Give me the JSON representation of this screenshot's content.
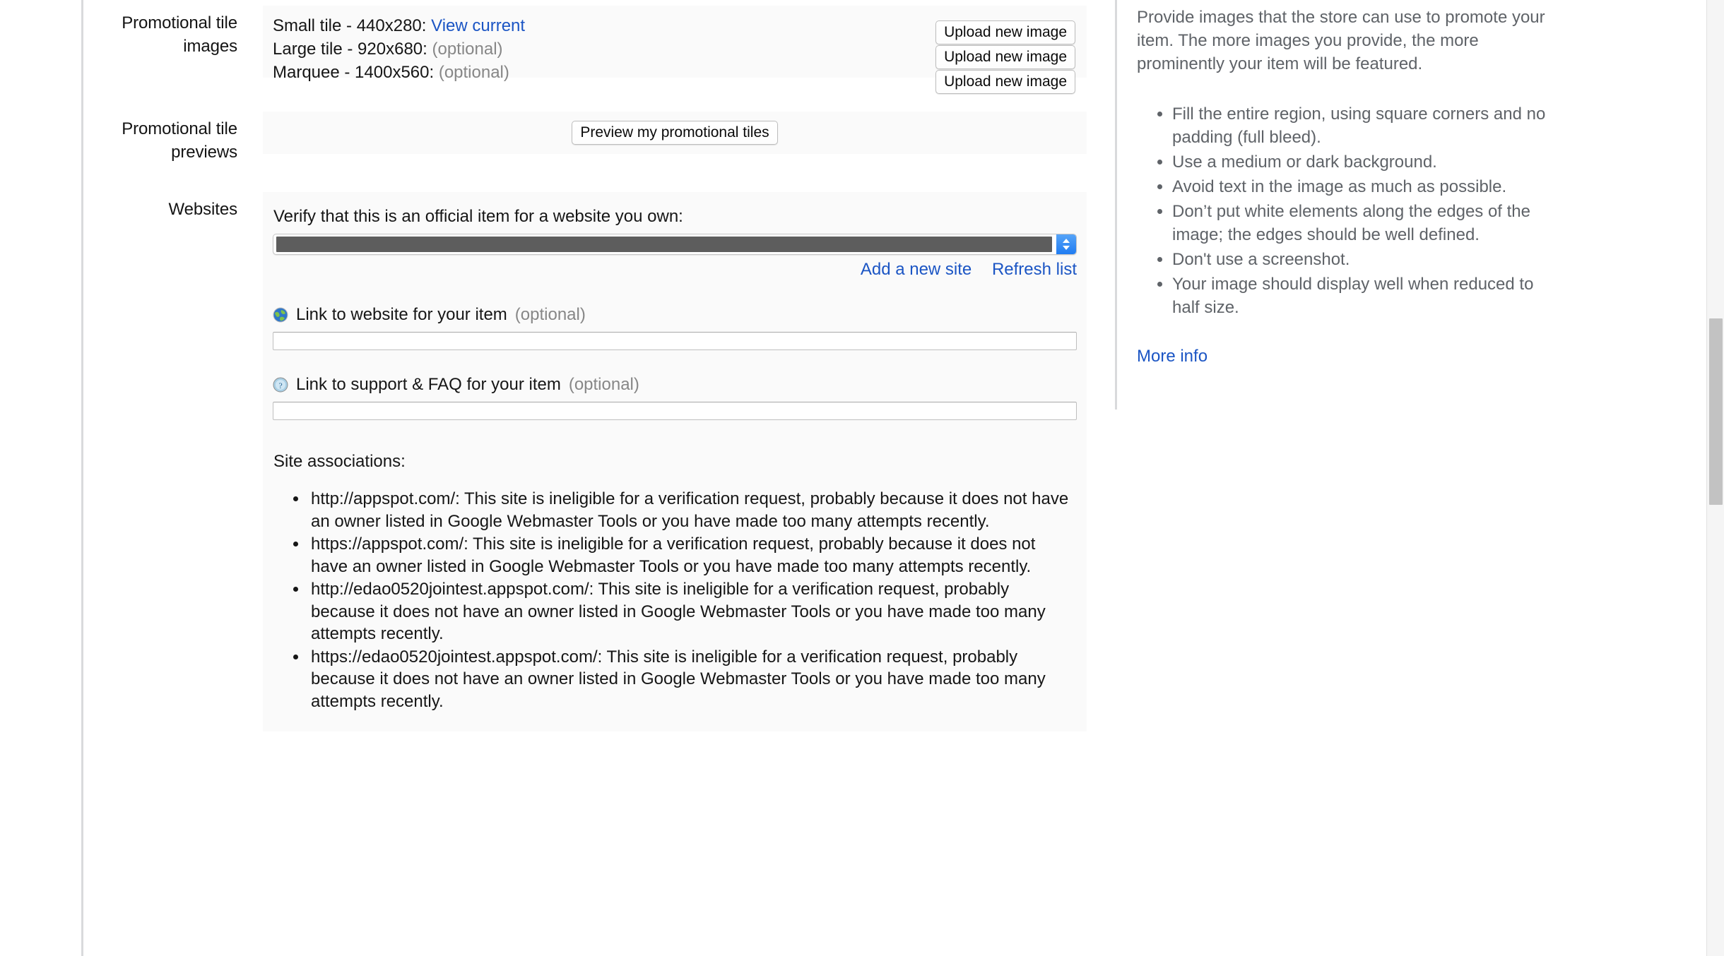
{
  "form": {
    "rows": [
      {
        "label": "Promotional tile\nimages"
      },
      {
        "label": "Promotional tile\npreviews"
      },
      {
        "label": "Websites"
      }
    ],
    "tiles": {
      "label_line1": "Promotional tile",
      "label_line2": "images",
      "items": [
        {
          "name": "Small tile - 440x280:",
          "status": "View current",
          "status_kind": "link"
        },
        {
          "name": "Large tile - 920x680:",
          "status": "(optional)",
          "status_kind": "muted"
        },
        {
          "name": "Marquee - 1400x560:",
          "status": "(optional)",
          "status_kind": "muted"
        }
      ],
      "upload_buttons": [
        "Upload new image",
        "Upload new image",
        "Upload new image"
      ]
    },
    "previews": {
      "label_line1": "Promotional tile",
      "label_line2": "previews",
      "button_label": "Preview my promotional tiles"
    },
    "websites": {
      "label": "Websites",
      "verify_text": "Verify that this is an official item for a website you own:",
      "site_select": {
        "value": "",
        "redacted": true,
        "stepper_icon": "chevron-up-down-icon"
      },
      "add_site_link": "Add a new site",
      "refresh_link": "Refresh list",
      "website_link_field": {
        "icon": "globe-icon",
        "label": "Link to website for your item",
        "optional_suffix": "(optional)",
        "value": "",
        "placeholder": ""
      },
      "support_link_field": {
        "icon": "question-circle-icon",
        "label": "Link to support & FAQ for your item",
        "optional_suffix": "(optional)",
        "value": "",
        "placeholder": ""
      },
      "associations_title": "Site associations:",
      "associations": [
        "http://appspot.com/: This site is ineligible for a verification request, probably because it does not have an owner listed in Google Webmaster Tools or you have made too many attempts recently.",
        "https://appspot.com/: This site is ineligible for a verification request, probably because it does not have an owner listed in Google Webmaster Tools or you have made too many attempts recently.",
        "http://edao0520jointest.appspot.com/: This site is ineligible for a verification request, probably because it does not have an owner listed in Google Webmaster Tools or you have made too many attempts recently.",
        "https://edao0520jointest.appspot.com/: This site is ineligible for a verification request, probably because it does not have an owner listed in Google Webmaster Tools or you have made too many attempts recently."
      ]
    }
  },
  "help": {
    "intro": "Provide images that the store can use to promote your item. The more images you provide, the more prominently your item will be featured.",
    "bullets": [
      "Fill the entire region, using square corners and no padding (full bleed).",
      "Use a medium or dark background.",
      "Avoid text in the image as much as possible.",
      "Don’t put white elements along the edges of the image; the edges should be well defined.",
      "Don't use a screenshot.",
      "Your image should display well when reduced to half size."
    ],
    "more_info_link": "More info"
  },
  "colors": {
    "link": "#1b55c4",
    "panel": "#fafafa",
    "text": "#161616",
    "muted": "#878787",
    "help_text": "#5f6368",
    "stepper_blue": "#1f7cf2",
    "redacted_value": "#5d5d5d"
  }
}
